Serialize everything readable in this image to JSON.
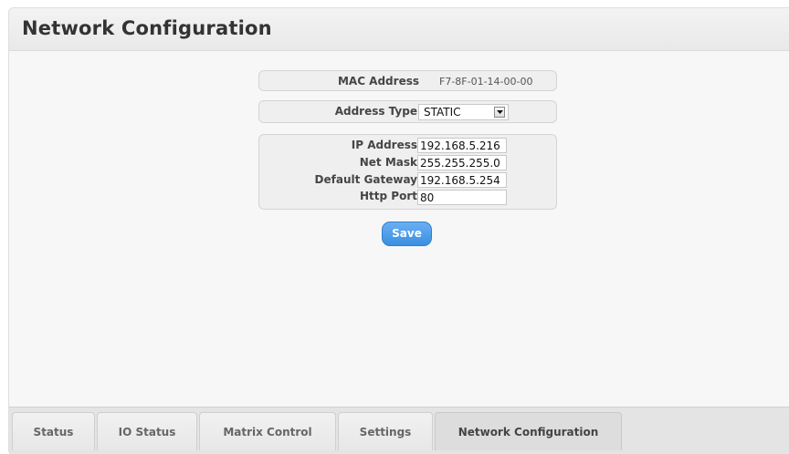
{
  "page": {
    "title": "Network Configuration"
  },
  "mac": {
    "label": "MAC Address",
    "value": "F7-8F-01-14-00-00"
  },
  "address_type": {
    "label": "Address Type",
    "value": "STATIC"
  },
  "network": {
    "ip_label": "IP Address",
    "ip_value": "192.168.5.216",
    "mask_label": "Net Mask",
    "mask_value": "255.255.255.0",
    "gateway_label": "Default Gateway",
    "gateway_value": "192.168.5.254",
    "port_label": "Http Port",
    "port_value": "80"
  },
  "actions": {
    "save_label": "Save"
  },
  "tabs": [
    {
      "label": "Status",
      "active": false
    },
    {
      "label": "IO Status",
      "active": false
    },
    {
      "label": "Matrix Control",
      "active": false
    },
    {
      "label": "Settings",
      "active": false
    },
    {
      "label": "Network Configuration",
      "active": true
    }
  ],
  "colors": {
    "accent": "#3a8fe0",
    "panel_bg": "#f7f7f7",
    "tab_active": "#dddddd"
  }
}
